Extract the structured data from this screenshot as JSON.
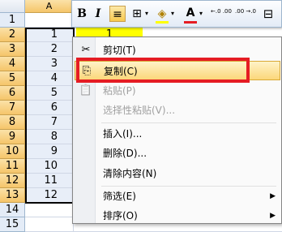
{
  "grid": {
    "column_a_header": "A",
    "row_numbers": [
      "1",
      "2",
      "3",
      "4",
      "5",
      "6",
      "7",
      "8",
      "9",
      "10",
      "11",
      "12",
      "13",
      "14",
      "15"
    ],
    "column_a_values": [
      "",
      "1",
      "2",
      "3",
      "4",
      "5",
      "6",
      "7",
      "8",
      "9",
      "10",
      "11",
      "12",
      "",
      ""
    ],
    "cell_b2_value": "1"
  },
  "toolbar": {
    "bold": "B",
    "italic": "I",
    "align_center": "≡",
    "borders": "⊞",
    "fill_color": "◈",
    "font_color": "A",
    "increase_decimal": "←.0 .00",
    "decrease_decimal": ".00 →.0",
    "format": "⊟"
  },
  "context_menu": {
    "items": [
      {
        "label": "剪切(T)",
        "icon": "✂"
      },
      {
        "label": "复制(C)",
        "icon": "⎘"
      },
      {
        "label": "粘贴(P)",
        "icon": "📋"
      },
      {
        "label": "选择性粘贴(V)...",
        "icon": ""
      },
      {
        "label": "插入(I)...",
        "icon": ""
      },
      {
        "label": "删除(D)...",
        "icon": ""
      },
      {
        "label": "清除内容(N)",
        "icon": ""
      },
      {
        "label": "筛选(E)",
        "icon": ""
      },
      {
        "label": "排序(O)",
        "icon": ""
      }
    ],
    "submenu_arrow": "▶"
  },
  "colors": {
    "highlight_box": "#e51c23",
    "cell_fill": "#ffff00",
    "font_color_bar": "#e51c23"
  }
}
